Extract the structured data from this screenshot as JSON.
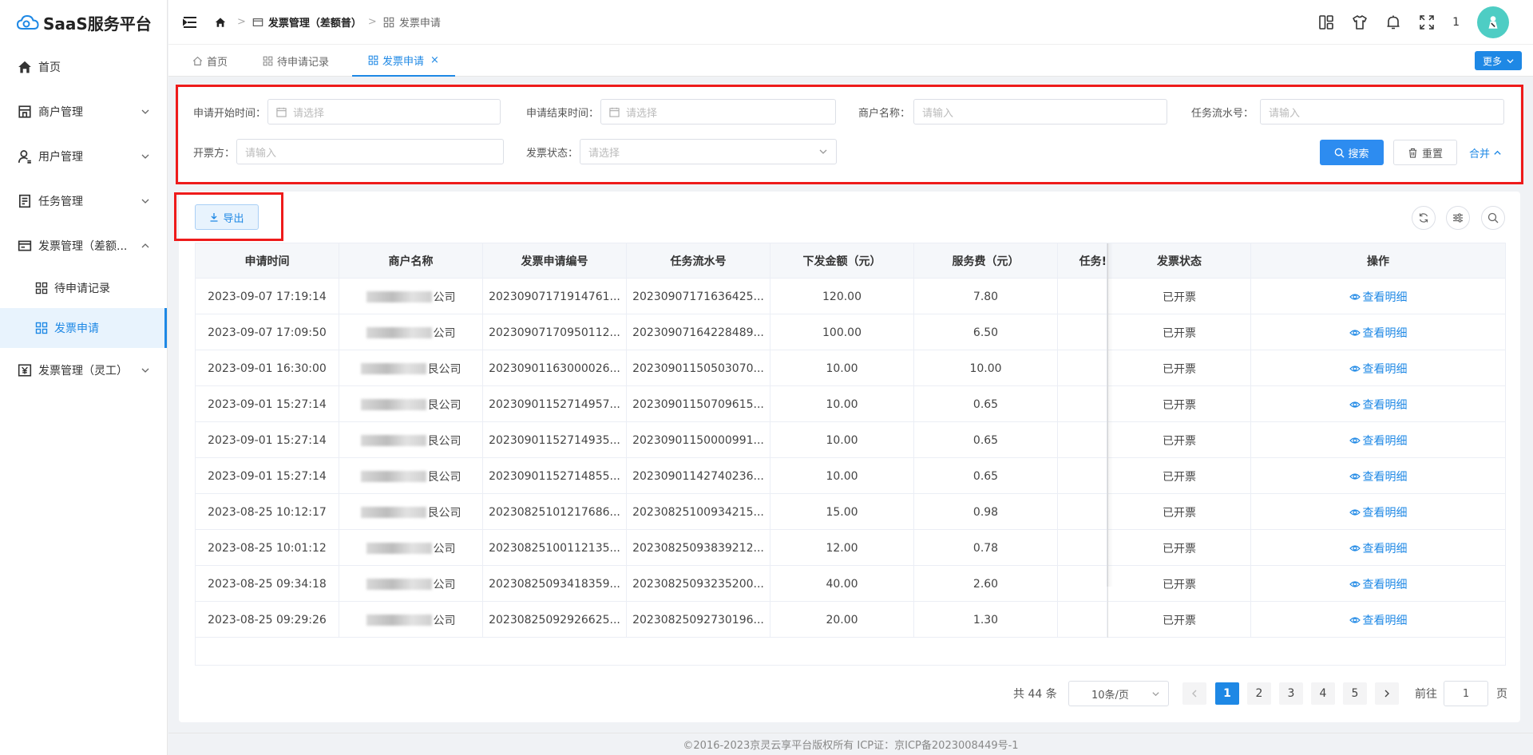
{
  "app": {
    "title": "SaaS服务平台"
  },
  "sidebar": {
    "items": [
      {
        "label": "首页"
      },
      {
        "label": "商户管理"
      },
      {
        "label": "用户管理"
      },
      {
        "label": "任务管理"
      },
      {
        "label": "发票管理（差额...",
        "sub": [
          {
            "label": "待申请记录"
          },
          {
            "label": "发票申请"
          }
        ]
      },
      {
        "label": "发票管理（灵工）"
      }
    ]
  },
  "header": {
    "breadcrumbs": [
      "发票管理（差额普）",
      "发票申请"
    ],
    "badge_count": "1"
  },
  "tabs": [
    {
      "label": "首页"
    },
    {
      "label": "待申请记录"
    },
    {
      "label": "发票申请",
      "close": "×"
    }
  ],
  "more_label": "更多",
  "filters": {
    "start_time": {
      "label": "申请开始时间：",
      "placeholder": "请选择"
    },
    "end_time": {
      "label": "申请结束时间：",
      "placeholder": "请选择"
    },
    "merchant": {
      "label": "商户名称：",
      "placeholder": "请输入"
    },
    "task_no": {
      "label": "任务流水号：",
      "placeholder": "请输入"
    },
    "issuer": {
      "label": "开票方：",
      "placeholder": "请输入"
    },
    "status": {
      "label": "发票状态：",
      "placeholder": "请选择"
    },
    "search_label": "搜索",
    "reset_label": "重置",
    "collapse_label": "合并"
  },
  "toolbar": {
    "export_label": "导出"
  },
  "table": {
    "columns": [
      "申请时间",
      "商户名称",
      "发票申请编号",
      "任务流水号",
      "下发金额（元）",
      "服务费（元）",
      "任务!",
      "发票状态",
      "操作"
    ],
    "merchant_suffix": "公司",
    "action_label": "查看明细",
    "rows": [
      {
        "time": "2023-09-07 17:19:14",
        "merchant_tail": "公司",
        "apply_no": "20230907171914761...",
        "task_no": "20230907171636425...",
        "amount": "120.00",
        "fee": "7.80",
        "status": "已开票"
      },
      {
        "time": "2023-09-07 17:09:50",
        "merchant_tail": "公司",
        "apply_no": "20230907170950112...",
        "task_no": "20230907164228489...",
        "amount": "100.00",
        "fee": "6.50",
        "status": "已开票"
      },
      {
        "time": "2023-09-01 16:30:00",
        "merchant_tail": "艮公司",
        "apply_no": "20230901163000026...",
        "task_no": "20230901150503070...",
        "amount": "10.00",
        "fee": "10.00",
        "status": "已开票"
      },
      {
        "time": "2023-09-01 15:27:14",
        "merchant_tail": "艮公司",
        "apply_no": "20230901152714957...",
        "task_no": "20230901150709615...",
        "amount": "10.00",
        "fee": "0.65",
        "status": "已开票"
      },
      {
        "time": "2023-09-01 15:27:14",
        "merchant_tail": "艮公司",
        "apply_no": "20230901152714935...",
        "task_no": "20230901150000991...",
        "amount": "10.00",
        "fee": "0.65",
        "status": "已开票"
      },
      {
        "time": "2023-09-01 15:27:14",
        "merchant_tail": "艮公司",
        "apply_no": "20230901152714855...",
        "task_no": "20230901142740236...",
        "amount": "10.00",
        "fee": "0.65",
        "status": "已开票"
      },
      {
        "time": "2023-08-25 10:12:17",
        "merchant_tail": "艮公司",
        "apply_no": "20230825101217686...",
        "task_no": "20230825100934215...",
        "amount": "15.00",
        "fee": "0.98",
        "status": "已开票"
      },
      {
        "time": "2023-08-25 10:01:12",
        "merchant_tail": "公司",
        "apply_no": "20230825100112135...",
        "task_no": "20230825093839212...",
        "amount": "12.00",
        "fee": "0.78",
        "status": "已开票"
      },
      {
        "time": "2023-08-25 09:34:18",
        "merchant_tail": "公司",
        "apply_no": "20230825093418359...",
        "task_no": "20230825093235200...",
        "amount": "40.00",
        "fee": "2.60",
        "status": "已开票"
      },
      {
        "time": "2023-08-25 09:29:26",
        "merchant_tail": "公司",
        "apply_no": "20230825092926625...",
        "task_no": "20230825092730196...",
        "amount": "20.00",
        "fee": "1.30",
        "status": "已开票"
      }
    ]
  },
  "pagination": {
    "total": "共 44 条",
    "page_size": "10条/页",
    "pages": [
      "1",
      "2",
      "3",
      "4",
      "5"
    ],
    "goto_label": "前往",
    "goto_value": "1",
    "page_suffix": "页"
  },
  "footer": {
    "text": "©2016-2023京灵云享平台版权所有 ICP证：京ICP备2023008449号-1"
  },
  "colors": {
    "accent": "#1e88e5",
    "highlight_box": "#ee1b1b"
  },
  "icons": [
    "cloud-logo-icon",
    "home-icon",
    "shop-icon",
    "user-icon",
    "task-icon",
    "invoice-icon",
    "grid-icon",
    "yen-icon",
    "hamburger-icon",
    "layout-icon",
    "shirt-icon",
    "bell-icon",
    "fullscreen-icon",
    "calendar-icon",
    "search-icon",
    "trash-icon",
    "download-icon",
    "refresh-icon",
    "sliders-icon",
    "eye-icon"
  ]
}
